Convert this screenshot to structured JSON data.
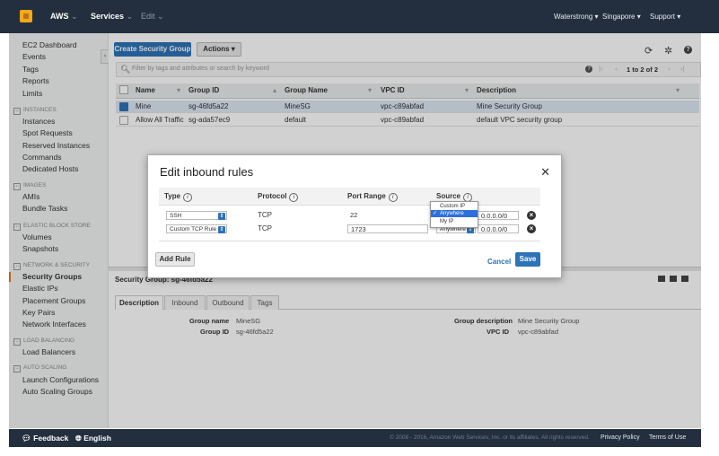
{
  "topbar": {
    "logo": "aws-cube-icon",
    "aws_label": "AWS",
    "services_label": "Services",
    "edit_label": "Edit",
    "account": "Waterstrong",
    "region": "Singapore",
    "support": "Support"
  },
  "sidebar": {
    "top_items": [
      "EC2 Dashboard",
      "Events",
      "Tags",
      "Reports",
      "Limits"
    ],
    "sections": [
      {
        "title": "INSTANCES",
        "items": [
          "Instances",
          "Spot Requests",
          "Reserved Instances",
          "Commands",
          "Dedicated Hosts"
        ]
      },
      {
        "title": "IMAGES",
        "items": [
          "AMIs",
          "Bundle Tasks"
        ]
      },
      {
        "title": "ELASTIC BLOCK STORE",
        "items": [
          "Volumes",
          "Snapshots"
        ]
      },
      {
        "title": "NETWORK & SECURITY",
        "items": [
          "Security Groups",
          "Elastic IPs",
          "Placement Groups",
          "Key Pairs",
          "Network Interfaces"
        ]
      },
      {
        "title": "LOAD BALANCING",
        "items": [
          "Load Balancers"
        ]
      },
      {
        "title": "AUTO SCALING",
        "items": [
          "Launch Configurations",
          "Auto Scaling Groups"
        ]
      }
    ]
  },
  "toolbar": {
    "create_label": "Create Security Group",
    "actions_label": "Actions",
    "search_placeholder": "Filter by tags and attributes or search by keyword",
    "pagination": "1 to 2 of 2"
  },
  "table": {
    "columns": [
      "Name",
      "Group ID",
      "Group Name",
      "VPC ID",
      "Description"
    ],
    "rows": [
      {
        "name": "Mine",
        "group_id": "sg-46fd5a22",
        "group_name": "MineSG",
        "vpc_id": "vpc-c89abfad",
        "description": "Mine Security Group",
        "selected": true
      },
      {
        "name": "Allow All Traffic",
        "group_id": "sg-ada57ec9",
        "group_name": "default",
        "vpc_id": "vpc-c89abfad",
        "description": "default VPC security group",
        "selected": false
      }
    ]
  },
  "details": {
    "header": "Security Group: sg-46fd5a22",
    "tabs": [
      "Description",
      "Inbound",
      "Outbound",
      "Tags"
    ],
    "group_name_label": "Group name",
    "group_name_value": "MineSG",
    "group_id_label": "Group ID",
    "group_id_value": "sg-46fd5a22",
    "group_desc_label": "Group description",
    "group_desc_value": "Mine Security Group",
    "vpc_id_label": "VPC ID",
    "vpc_id_value": "vpc-c89abfad"
  },
  "modal": {
    "title": "Edit inbound rules",
    "columns": [
      "Type",
      "Protocol",
      "Port Range",
      "Source"
    ],
    "rows": [
      {
        "type": "SSH",
        "protocol": "TCP",
        "port": "22",
        "source_sel": "Anywhere",
        "cidr": "0.0.0.0/0"
      },
      {
        "type": "Custom TCP Rule",
        "protocol": "TCP",
        "port": "1723",
        "source_sel": "Anywhere",
        "cidr": "0.0.0.0/0"
      }
    ],
    "add_rule": "Add Rule",
    "cancel": "Cancel",
    "save": "Save",
    "source_options": [
      "Custom IP",
      "Anywhere",
      "My IP"
    ],
    "source_selected": "Anywhere"
  },
  "footer": {
    "feedback": "Feedback",
    "language": "English",
    "copyright": "© 2008 - 2016, Amazon Web Services, Inc. or its affiliates. All rights reserved.",
    "privacy": "Privacy Policy",
    "terms": "Terms of Use"
  },
  "colors": {
    "accent": "#2e73b8",
    "topbar": "#232f3e",
    "active": "#e47911"
  }
}
